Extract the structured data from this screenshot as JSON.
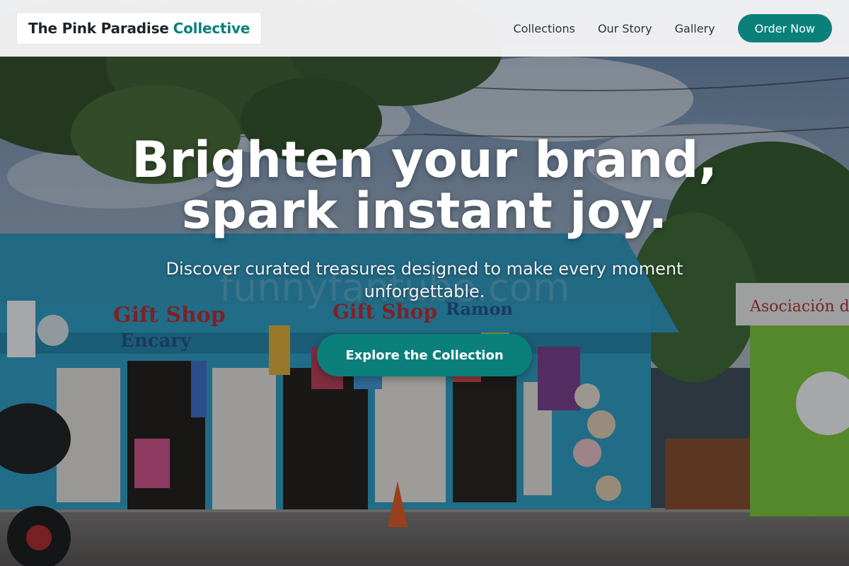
{
  "brand": {
    "name_main": "The Pink Paradise",
    "name_accent": "Collective"
  },
  "nav": {
    "links": [
      "Collections",
      "Our Story",
      "Gallery"
    ],
    "order_button": "Order Now"
  },
  "hero": {
    "title": "Brighten your brand, spark instant joy.",
    "subtitle": "Discover curated treasures designed to make every moment unforgettable.",
    "cta": "Explore the Collection",
    "background_image_alt": "Colorful street souvenir gift shops under a cloudy sky"
  },
  "colors": {
    "accent": "#0b807b",
    "header_bg": "#f5f5f5",
    "brand_text": "#1d2428"
  }
}
